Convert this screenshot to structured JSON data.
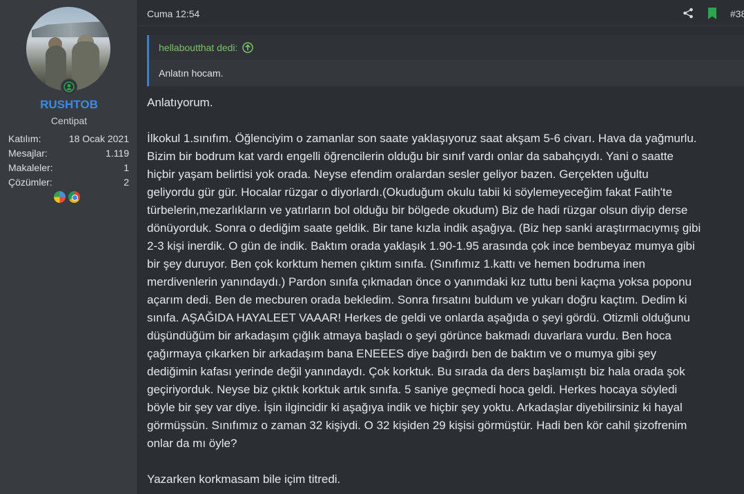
{
  "user": {
    "name": "RUSHTOB",
    "title": "Centipat",
    "stats": [
      {
        "label": "Katılım:",
        "value": "18 Ocak 2021"
      },
      {
        "label": "Mesajlar:",
        "value": "1.119"
      },
      {
        "label": "Makaleler:",
        "value": "1"
      },
      {
        "label": "Çözümler:",
        "value": "2"
      }
    ],
    "online_icon": "user-online-icon",
    "trophy_icons": [
      "windows-trophy-icon",
      "chrome-trophy-icon"
    ]
  },
  "post": {
    "date": "Cuma 12:54",
    "number": "#38",
    "share_icon": "share-icon",
    "bookmark_icon": "bookmark-icon",
    "quote": {
      "author": "hellaboutthat dedi:",
      "text": "Anlatın hocam."
    },
    "lines": [
      "Anlatıyorum.",
      "",
      "İlkokul 1.sınıfım. Öğlenciyim o zamanlar son saate yaklaşıyoruz saat akşam 5-6 civarı. Hava da yağmurlu.",
      "Bizim bir bodrum kat vardı engelli öğrencilerin olduğu bir sınıf vardı onlar da sabahçıydı. Yani o saatte",
      "hiçbir yaşam belirtisi yok orada. Neyse efendim oralardan sesler geliyor bazen. Gerçekten uğultu",
      "geliyordu gür gür. Hocalar rüzgar o diyorlardı.(Okuduğum okulu tabii ki söylemeyeceğim fakat Fatih'te",
      "türbelerin,mezarlıkların ve yatırların bol olduğu bir bölgede okudum) Biz de hadi rüzgar olsun diyip derse",
      "dönüyorduk. Sonra o dediğim saate geldik. Bir tane kızla indik aşağıya. (Biz hep sanki araştırmacıymış gibi",
      "2-3 kişi inerdik. O gün de indik. Baktım orada yaklaşık 1.90-1.95 arasında çok ince bembeyaz mumya gibi",
      "bir şey duruyor. Ben çok korktum hemen çıktım sınıfa. (Sınıfımız 1.kattı ve hemen bodruma inen",
      "merdivenlerin yanındaydı.) Pardon sınıfa çıkmadan önce o yanımdaki kız tuttu beni kaçma yoksa poponu",
      "açarım dedi. Ben de mecburen orada bekledim. Sonra fırsatını buldum ve yukarı doğru kaçtım. Dedim ki",
      "sınıfa. AŞAĞIDA HAYALEET VAAAR! Herkes de geldi ve onlarda aşağıda o şeyi gördü. Otizmli olduğunu",
      "düşündüğüm bir arkadaşım çığlık atmaya başladı o şeyi görünce bakmadı duvarlara vurdu. Ben hoca",
      "çağırmaya çıkarken bir arkadaşım bana ENEEES diye bağırdı ben de baktım ve o mumya gibi şey",
      "dediğimin kafası yerinde değil yanındaydı. Çok korktuk. Bu sırada da ders başlamıştı biz hala orada şok",
      "geçiriyorduk. Neyse biz çıktık korktuk artık sınıfa. 5 saniye geçmedi hoca geldi. Herkes hocaya söyledi",
      "böyle bir şey var diye. İşin ilgincidir ki aşağıya indik ve hiçbir şey yoktu. Arkadaşlar diyebilirsiniz ki hayal",
      "görmüşsün. Sınıfımız o zaman 32 kişiydi. O 32 kişiden 29 kişisi görmüştür. Hadi ben kör cahil şizofrenim",
      "onlar da mı öyle?",
      "",
      "Yazarken korkmasam bile içim titredi."
    ]
  },
  "colors": {
    "username": "#3b8ae6",
    "quote_author": "#7dc36b",
    "bookmark": "#2ea44f",
    "online": "#2ea44f"
  }
}
